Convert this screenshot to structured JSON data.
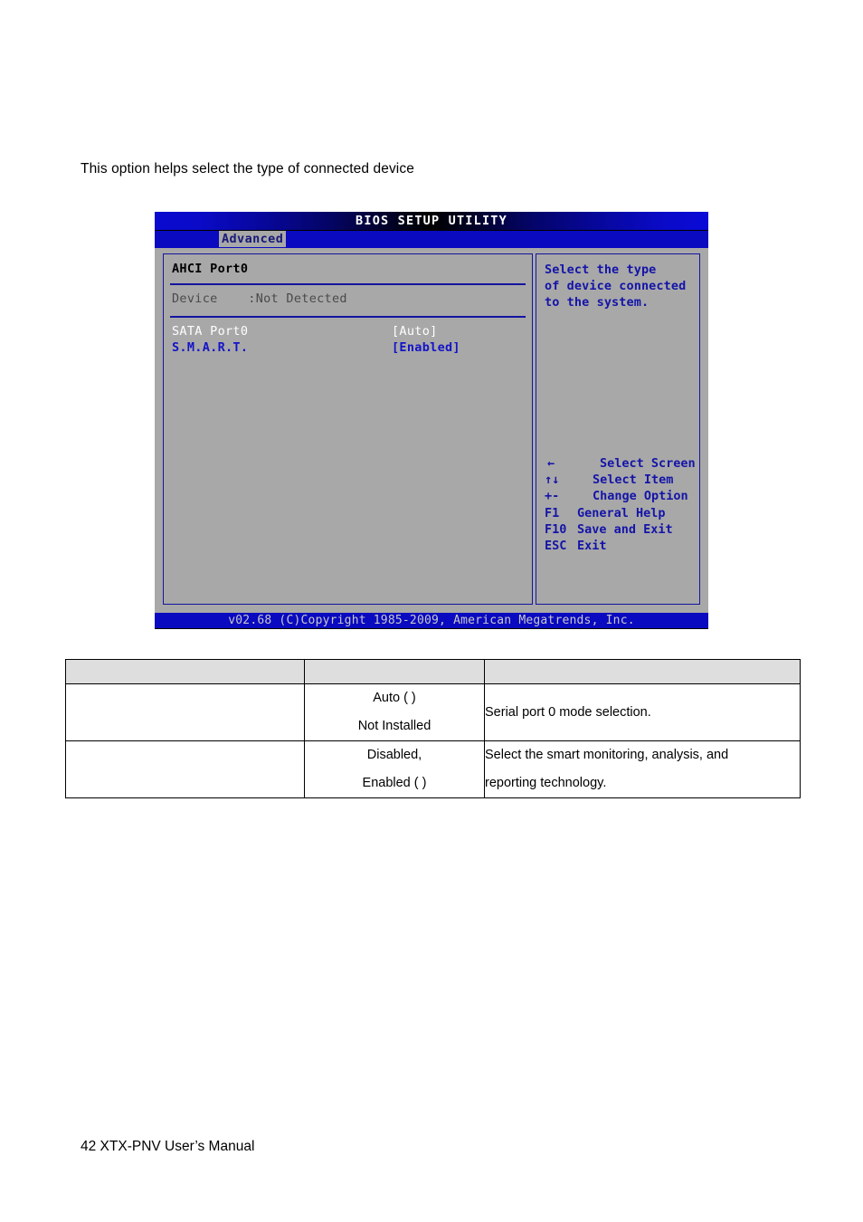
{
  "page": {
    "intro_text": "This option helps select the type of connected device",
    "footer_text": "42 XTX-PNV User’s Manual"
  },
  "bios": {
    "title": "BIOS SETUP UTILITY",
    "active_tab": "Advanced",
    "section_title": "AHCI Port0",
    "device_row": "Device    :Not Detected",
    "options": [
      {
        "label": "SATA Port0",
        "value": "[Auto]",
        "selected": true
      },
      {
        "label": "S.M.A.R.T.",
        "value": "[Enabled]",
        "selected": false
      }
    ],
    "help": {
      "line1": "Select the type",
      "line2": "of device connected",
      "line3": "to the system."
    },
    "nav": [
      {
        "key": "←",
        "desc": "Select Screen"
      },
      {
        "key": "↑↓",
        "desc": "Select Item"
      },
      {
        "key": "+-",
        "desc": "Change Option"
      },
      {
        "key": "F1",
        "desc": "General Help"
      },
      {
        "key": "F10",
        "desc": "Save and Exit"
      },
      {
        "key": "ESC",
        "desc": "Exit"
      }
    ],
    "footer": "v02.68 (C)Copyright 1985-2009, American Megatrends, Inc.",
    "colors": {
      "screen_bg": "#a8a8a8",
      "accent_blue": "#1414a0",
      "title_blue": "#0a0ac0",
      "selected_text": "#ffffff",
      "option_text": "#1414c8"
    }
  },
  "table": {
    "headers": [
      "",
      "",
      ""
    ],
    "rows": [
      {
        "name": "",
        "values_line1": "Auto (            )",
        "values_line2": "Not Installed",
        "description_line1": "Serial port 0 mode selection.",
        "description_line2": ""
      },
      {
        "name": "",
        "values_line1": "Disabled,",
        "values_line2": "Enabled (            )",
        "description_line1": "Select the smart monitoring, analysis, and",
        "description_line2": "reporting technology."
      }
    ]
  }
}
